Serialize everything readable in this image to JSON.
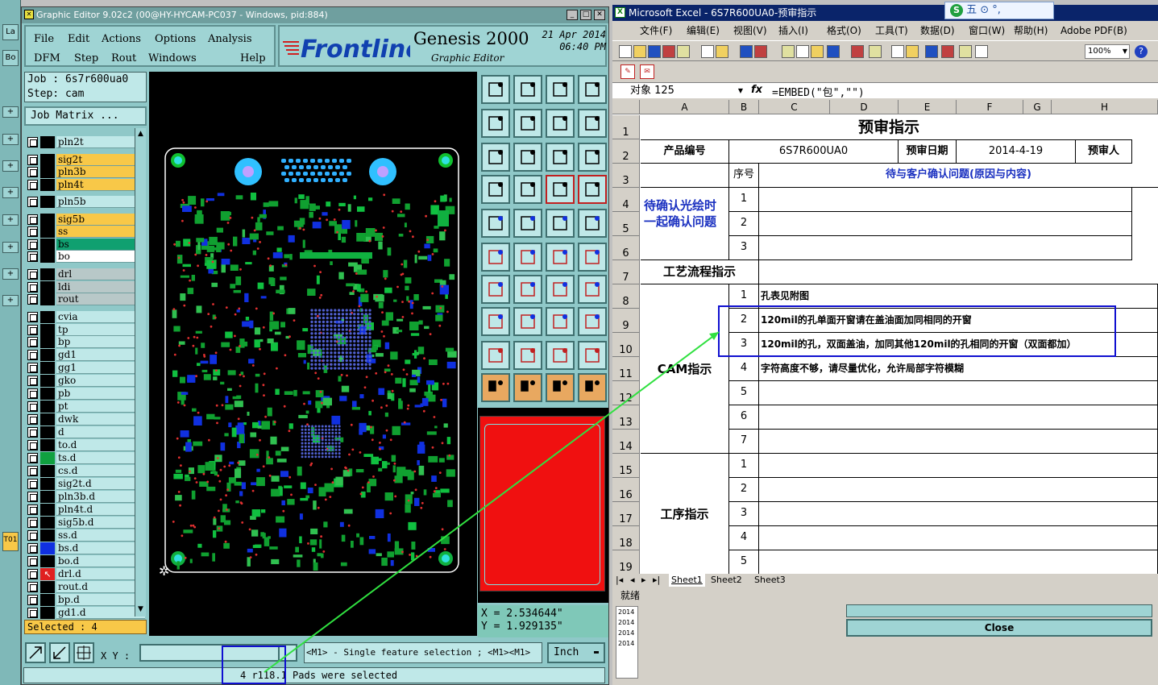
{
  "left_strip": {
    "tabs": [
      "La",
      "Bo",
      "T01"
    ]
  },
  "genesis": {
    "title": "Graphic Editor 9.02c2 (00@HY-HYCAM-PC037 - Windows, pid:884)",
    "menu": {
      "row1": [
        "File",
        "Edit",
        "Actions",
        "Options",
        "Analysis"
      ],
      "row2": [
        "DFM",
        "Step",
        "Rout",
        "Windows",
        "Help"
      ]
    },
    "brand": {
      "logo": "Frontline",
      "product": "Genesis 2000",
      "subtitle": "Graphic Editor",
      "date": "21 Apr 2014",
      "time": "06:40 PM"
    },
    "job": "Job  : 6s7r600ua0",
    "step": "Step: cam",
    "job_matrix": "Job Matrix ...",
    "layers": [
      {
        "name": "pln2t",
        "color": "#000000",
        "row": "cyan"
      },
      {
        "name": "sig2t",
        "color": "#000000",
        "row": "orange",
        "icon": "✐"
      },
      {
        "name": "pln3b",
        "color": "#000000",
        "row": "orange",
        "icon": "✐"
      },
      {
        "name": "pln4t",
        "color": "#000000",
        "row": "orange",
        "icon": "✐"
      },
      {
        "name": "pln5b",
        "color": "#000000",
        "row": "cyan"
      },
      {
        "name": "sig5b",
        "color": "#000000",
        "row": "orange",
        "icon": "✐"
      },
      {
        "name": "ss",
        "color": "#000000",
        "row": "orange",
        "icon": "✐"
      },
      {
        "name": "bs",
        "color": "#000000",
        "row": "green"
      },
      {
        "name": "bo",
        "color": "#000000",
        "row": "white"
      },
      {
        "name": "drl",
        "color": "#000000",
        "row": "gray"
      },
      {
        "name": "ldi",
        "color": "#000000",
        "row": "gray"
      },
      {
        "name": "rout",
        "color": "#000000",
        "row": "gray"
      },
      {
        "name": "cvia",
        "color": "#000000",
        "row": "cyan"
      },
      {
        "name": "tp",
        "color": "#000000",
        "row": "cyan"
      },
      {
        "name": "bp",
        "color": "#000000",
        "row": "cyan"
      },
      {
        "name": "gd1",
        "color": "#000000",
        "row": "cyan",
        "icon": "✐"
      },
      {
        "name": "gg1",
        "color": "#000000",
        "row": "cyan"
      },
      {
        "name": "gko",
        "color": "#000000",
        "row": "cyan"
      },
      {
        "name": "pb",
        "color": "#000000",
        "row": "cyan"
      },
      {
        "name": "pt",
        "color": "#000000",
        "row": "cyan"
      },
      {
        "name": "dwk",
        "color": "#000000",
        "row": "cyan"
      },
      {
        "name": "d",
        "color": "#000000",
        "row": "cyan"
      },
      {
        "name": "to.d",
        "color": "#000000",
        "row": "cyan",
        "icon": "✐"
      },
      {
        "name": "ts.d",
        "color": "#10a040",
        "row": "cyan"
      },
      {
        "name": "cs.d",
        "color": "#000000",
        "row": "cyan",
        "icon": "✐"
      },
      {
        "name": "sig2t.d",
        "color": "#000000",
        "row": "cyan",
        "icon": "✐"
      },
      {
        "name": "pln3b.d",
        "color": "#000000",
        "row": "cyan"
      },
      {
        "name": "pln4t.d",
        "color": "#000000",
        "row": "cyan",
        "icon": "✐"
      },
      {
        "name": "sig5b.d",
        "color": "#000000",
        "row": "cyan",
        "icon": "✐"
      },
      {
        "name": "ss.d",
        "color": "#000000",
        "row": "cyan",
        "icon": "✐"
      },
      {
        "name": "bs.d",
        "color": "#1030e0",
        "row": "cyan"
      },
      {
        "name": "bo.d",
        "color": "#000000",
        "row": "cyan"
      },
      {
        "name": "drl.d",
        "color": "#e02020",
        "row": "cyan",
        "icon": "⊞"
      },
      {
        "name": "rout.d",
        "color": "#000000",
        "row": "cyan"
      },
      {
        "name": "bp.d",
        "color": "#000000",
        "row": "cyan"
      },
      {
        "name": "gd1.d",
        "color": "#000000",
        "row": "cyan",
        "icon": "✐"
      }
    ],
    "selected": "Selected : 4",
    "coords": {
      "x": "X  =  2.534644\"",
      "y": "Y  =  1.929135\""
    },
    "xy_label": "X Y :",
    "hint": "<M1> - Single feature selection ; <M1><M1>",
    "unit": "Inch",
    "status_highlight": "4 r118.1",
    "status_text": "Pads were selected"
  },
  "excel": {
    "title": "Microsoft Excel - 6S7R600UA0-预审指示",
    "ime": "五 ⊙ °,",
    "menu": [
      "文件(F)",
      "编辑(E)",
      "视图(V)",
      "插入(I)",
      "格式(O)",
      "工具(T)",
      "数据(D)",
      "窗口(W)",
      "帮助(H)",
      "Adobe PDF(B)"
    ],
    "zoom": "100%",
    "name_box": "对象 125",
    "fx": "fx",
    "formula": "=EMBED(\"包\",\"\")",
    "columns": [
      "A",
      "B",
      "C",
      "D",
      "E",
      "F",
      "G",
      "H"
    ],
    "rows": [
      "1",
      "2",
      "3",
      "4",
      "5",
      "6",
      "7",
      "8",
      "9",
      "10",
      "11",
      "12",
      "13",
      "14",
      "15",
      "16",
      "17",
      "18",
      "19"
    ],
    "sheet": {
      "title": "预审指示",
      "product_no_label": "产品编号",
      "product_no": "6S7R600UA0",
      "review_date_label": "预审日期",
      "review_date": "2014-4-19",
      "reviewer_label": "预审人",
      "seq_label": "序号",
      "issues_header": "待与客户确认问题(原因与内容)",
      "confirm_label": "待确认光绘时一起确认问题",
      "confirm_nums": [
        "1",
        "2",
        "3"
      ],
      "process_label": "工艺流程指示",
      "cam_label": "CAM指示",
      "cam_nums": [
        "1",
        "2",
        "3",
        "4",
        "5",
        "6",
        "7"
      ],
      "cam_items": [
        "孔表见附图",
        "120mil的孔单面开窗请在盖油面加同相同的开窗",
        "120mil的孔，双面盖油，加同其他120mil的孔相同的开窗（双面都加）",
        "字符高度不够，请尽量优化，允许局部字符模糊"
      ],
      "proc_label": "工序指示",
      "proc_nums": [
        "1",
        "2",
        "3",
        "4",
        "5"
      ]
    },
    "sheet_tabs": [
      "Sheet1",
      "Sheet2",
      "Sheet3"
    ],
    "ready": "就绪",
    "dialog_list": [
      "2014",
      "2014",
      "2014",
      "2014"
    ],
    "close_label": "Close"
  }
}
